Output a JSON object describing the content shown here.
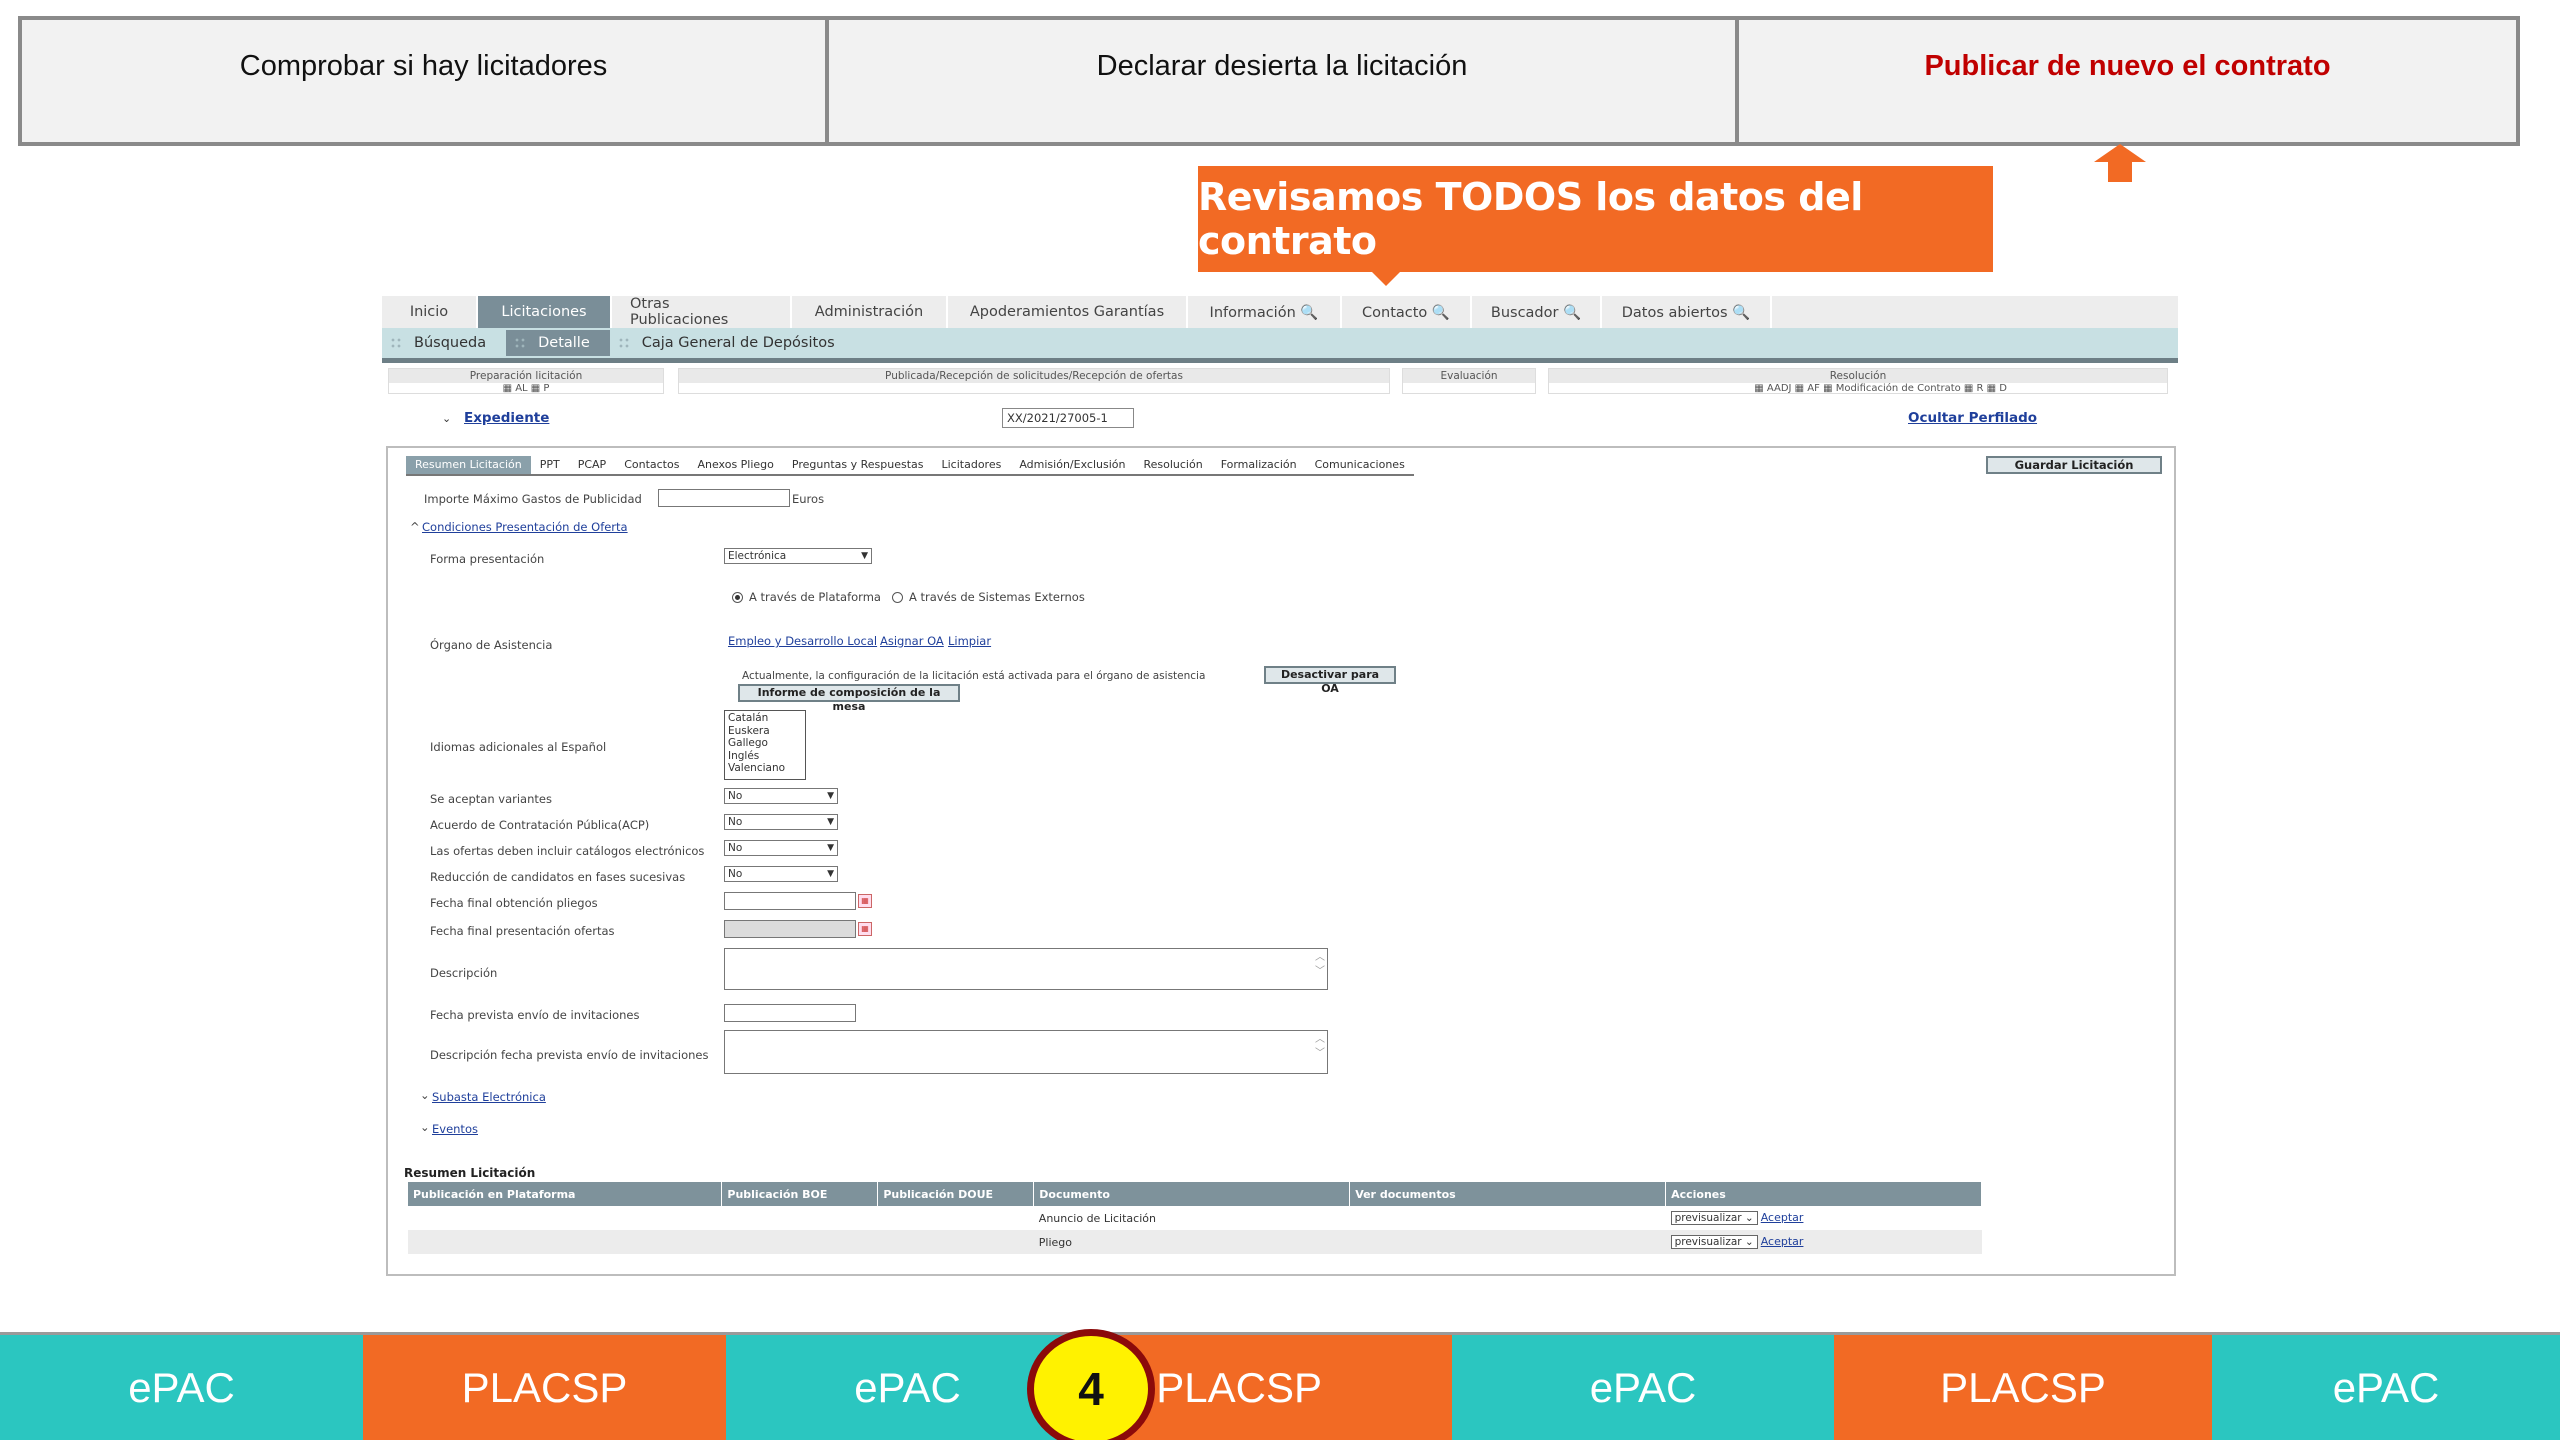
{
  "steps": [
    {
      "label": "Comprobar si hay licitadores"
    },
    {
      "label": "Declarar desierta la licitación"
    },
    {
      "label": "Publicar de nuevo el contrato"
    }
  ],
  "callout": {
    "text": "Revisamos TODOS los datos del contrato"
  },
  "app": {
    "menu": [
      "Inicio",
      "Licitaciones",
      "Otras Publicaciones",
      "Administración",
      "Apoderamientos Garantías",
      "Información 🔍",
      "Contacto 🔍",
      "Buscador 🔍",
      "Datos abiertos 🔍"
    ],
    "submenu": [
      "Búsqueda",
      "Detalle",
      "Caja General de Depósitos"
    ],
    "phases": [
      {
        "title": "Preparación licitación",
        "sub": "▦ AL ▦ P"
      },
      {
        "title": "Publicada/Recepción de solicitudes/Recepción de ofertas",
        "sub": ""
      },
      {
        "title": "Evaluación",
        "sub": ""
      },
      {
        "title": "Resolución",
        "sub": "▦ AADJ ▦ AF ▦ Modificación de Contrato ▦ R ▦ D"
      }
    ],
    "expediente": {
      "caret": "⌄",
      "label": "Expediente",
      "value": "XX/2021/27005-1",
      "ocultar": "Ocultar Perfilado"
    },
    "tabs": [
      "Resumen Licitación",
      "PPT",
      "PCAP",
      "Contactos",
      "Anexos Pliego",
      "Preguntas y Respuestas",
      "Licitadores",
      "Admisión/Exclusión",
      "Resolución",
      "Formalización",
      "Comunicaciones"
    ],
    "guardar": "Guardar Licitación",
    "form": {
      "importe_label": "Importe Máximo Gastos de Publicidad",
      "importe_unit": "Euros",
      "condiciones_caret": "^",
      "condiciones": "Condiciones Presentación de Oferta",
      "forma_label": "Forma presentación",
      "forma_value": "Electrónica",
      "radio1": "A través de Plataforma",
      "radio2": "A través de Sistemas Externos",
      "organo_label": "Órgano de Asistencia",
      "organo_link1": "Empleo y Desarrollo Local",
      "organo_link2": "Asignar OA",
      "organo_link3": "Limpiar",
      "actualmente": "Actualmente, la configuración de la licitación está activada para el órgano de asistencia",
      "desactivar": "Desactivar para OA",
      "informe": "Informe de composición de la mesa",
      "idiomas_label": "Idiomas adicionales al Español",
      "idiomas": [
        "Catalán",
        "Euskera",
        "Gallego",
        "Inglés",
        "Valenciano"
      ],
      "variantes_label": "Se aceptan variantes",
      "variantes_value": "No",
      "acp_label": "Acuerdo de Contratación Pública(ACP)",
      "acp_value": "No",
      "catalogos_label": "Las ofertas deben incluir catálogos electrónicos",
      "catalogos_value": "No",
      "reduccion_label": "Reducción de candidatos en fases sucesivas",
      "reduccion_value": "No",
      "fecha_pliegos_label": "Fecha final obtención pliegos",
      "fecha_ofertas_label": "Fecha final presentación ofertas",
      "descripcion_label": "Descripción",
      "fecha_invit_label": "Fecha prevista envío de invitaciones",
      "desc_fecha_invit_label": "Descripción fecha prevista envío de invitaciones",
      "subasta_caret": "⌄",
      "subasta": "Subasta Electrónica",
      "eventos_caret": "⌄",
      "eventos": "Eventos"
    },
    "resumen": {
      "title": "Resumen Licitación",
      "headers": [
        "Publicación en Plataforma",
        "Publicación BOE",
        "Publicación DOUE",
        "Documento",
        "Ver documentos",
        "Acciones"
      ],
      "rows": [
        {
          "documento": "Anuncio de Licitación",
          "accion": "previsualizar ⌄",
          "aceptar": "Aceptar"
        },
        {
          "documento": "Pliego",
          "accion": "previsualizar ⌄",
          "aceptar": "Aceptar"
        }
      ]
    }
  },
  "bottom": {
    "segments": [
      "ePAC",
      "PLACSP",
      "ePAC",
      "PLACSP",
      "ePAC",
      "PLACSP",
      "ePAC"
    ],
    "badge": "4"
  },
  "colors": {
    "orange": "#f26a24",
    "teal": "#2bc6c0",
    "active_step": "#c00000",
    "badge": "#fff200"
  }
}
